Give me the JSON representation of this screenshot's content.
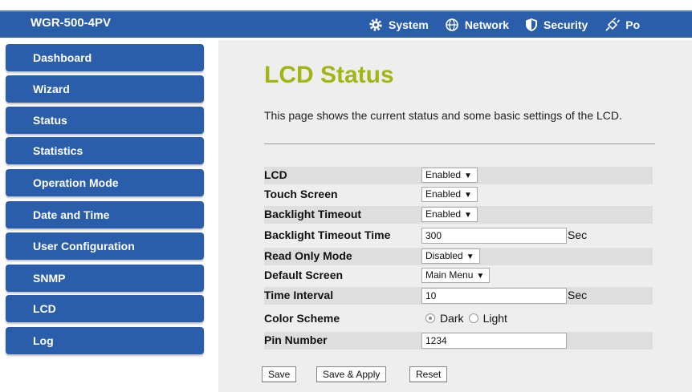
{
  "header": {
    "brand": "WGR-500-4PV",
    "nav": [
      {
        "label": "System",
        "icon": "gear-icon"
      },
      {
        "label": "Network",
        "icon": "globe-icon"
      },
      {
        "label": "Security",
        "icon": "shield-icon"
      },
      {
        "label": "Po",
        "icon": "plug-icon"
      }
    ]
  },
  "sidebar": {
    "items": [
      {
        "label": "Dashboard"
      },
      {
        "label": "Wizard"
      },
      {
        "label": "Status"
      },
      {
        "label": "Statistics"
      },
      {
        "label": "Operation Mode"
      },
      {
        "label": "Date and Time"
      },
      {
        "label": "User Configuration"
      },
      {
        "label": "SNMP"
      },
      {
        "label": "LCD"
      },
      {
        "label": "Log"
      }
    ]
  },
  "main": {
    "title": "LCD Status",
    "description": "This page shows the current status and some basic settings of the LCD.",
    "fields": {
      "lcd": {
        "label": "LCD",
        "value": "Enabled"
      },
      "touch_screen": {
        "label": "Touch Screen",
        "value": "Enabled"
      },
      "backlight_timeout": {
        "label": "Backlight Timeout",
        "value": "Enabled"
      },
      "backlight_timeout_time": {
        "label": "Backlight Timeout Time",
        "value": "300",
        "unit": "Sec"
      },
      "read_only_mode": {
        "label": "Read Only Mode",
        "value": "Disabled"
      },
      "default_screen": {
        "label": "Default Screen",
        "value": "Main Menu"
      },
      "time_interval": {
        "label": "Time Interval",
        "value": "10",
        "unit": "Sec"
      },
      "color_scheme": {
        "label": "Color Scheme",
        "options": [
          "Dark",
          "Light"
        ],
        "selected": "Dark"
      },
      "pin_number": {
        "label": "Pin Number",
        "value": "1234"
      }
    },
    "buttons": {
      "save": "Save",
      "save_apply": "Save & Apply",
      "reset": "Reset"
    }
  },
  "colors": {
    "primary": "#2a5eaa",
    "title": "#a3b515",
    "content_bg": "#eeeeee",
    "row_shade": "#dedede"
  }
}
